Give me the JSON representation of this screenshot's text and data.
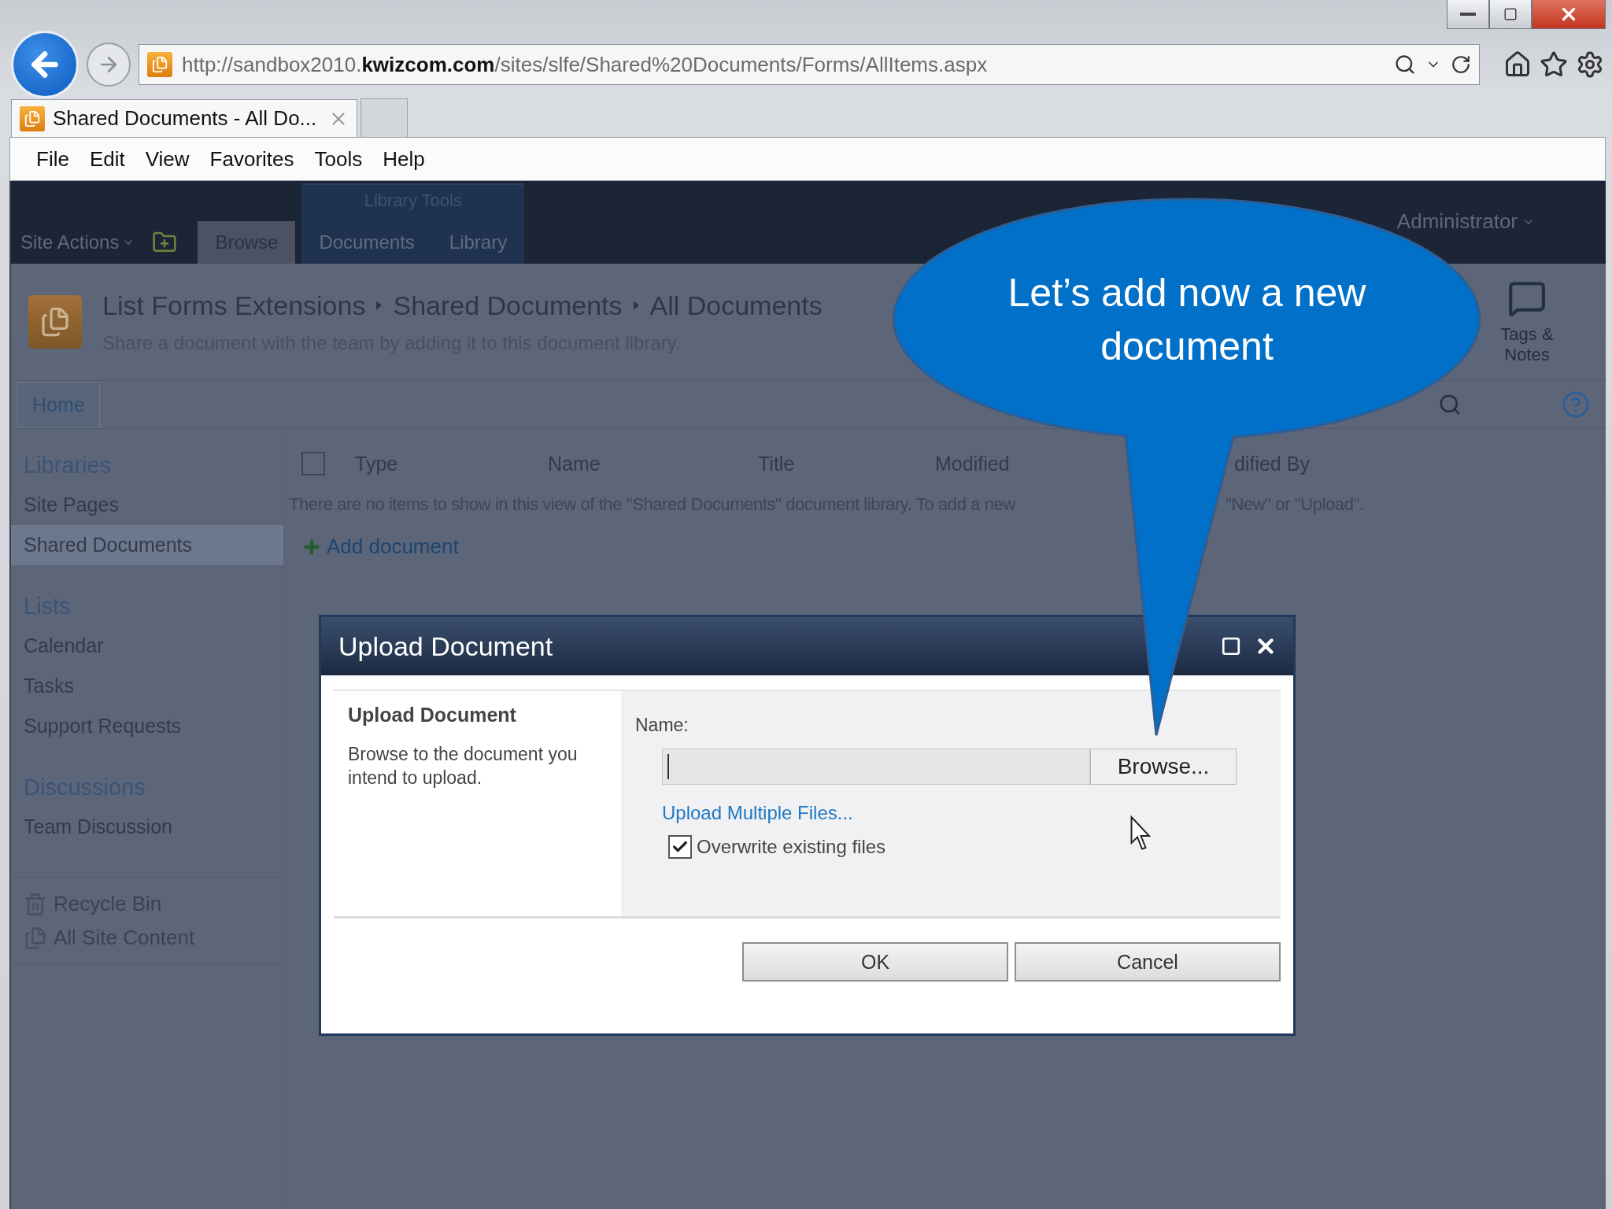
{
  "browser": {
    "address": "http://sandbox2010.**kwizcom.com**/sites/slfe/Shared%20Documents/Forms/AllItems.aspx",
    "tabs": [
      {
        "title": "Shared Documents - All Do...",
        "selected": true
      }
    ],
    "menu": [
      "File",
      "Edit",
      "View",
      "Favorites",
      "Tools",
      "Help"
    ]
  },
  "ribbon": {
    "site_actions": "Site Actions",
    "group_label": "Library Tools",
    "tabs": [
      {
        "label": "Browse",
        "selected": true
      },
      {
        "label": "Documents",
        "selected": false
      },
      {
        "label": "Library",
        "selected": false
      }
    ],
    "user": "Administrator"
  },
  "page": {
    "breadcrumb": [
      "List Forms Extensions",
      "Shared Documents",
      "All Documents"
    ],
    "description": "Share a document with the team by adding it to this document library.",
    "tags_notes": "Tags & Notes",
    "nav": [
      {
        "label": "Home",
        "selected": true
      }
    ]
  },
  "quick_launch": {
    "sections": [
      {
        "heading": "Libraries",
        "items": [
          {
            "label": "Site Pages",
            "selected": false
          },
          {
            "label": "Shared Documents",
            "selected": true
          }
        ]
      },
      {
        "heading": "Lists",
        "items": [
          {
            "label": "Calendar",
            "selected": false
          },
          {
            "label": "Tasks",
            "selected": false
          },
          {
            "label": "Support Requests",
            "selected": false
          }
        ]
      },
      {
        "heading": "Discussions",
        "items": [
          {
            "label": "Team Discussion",
            "selected": false
          }
        ]
      }
    ],
    "footer": [
      {
        "kind": "recycle",
        "label": "Recycle Bin"
      },
      {
        "kind": "content",
        "label": "All Site Content"
      }
    ]
  },
  "list": {
    "select_all_checked": false,
    "columns": [
      "Type",
      "Name",
      "Title",
      "Modified",
      "dified By"
    ],
    "empty_message": [
      "There are no items to show in this view of the \"Shared Documents\" document library. To add a new",
      "\"New\" or \"Upload\"."
    ],
    "add_link": "Add document"
  },
  "dialog": {
    "title": "Upload Document",
    "section_title": "Upload Document",
    "section_text": "Browse to the document you intend to upload.",
    "name_label": "Name:",
    "browse": "Browse...",
    "upload_multiple": "Upload Multiple Files...",
    "overwrite": {
      "label": "Overwrite existing files",
      "checked": true
    },
    "buttons": [
      "OK",
      "Cancel"
    ]
  },
  "callout": {
    "text": "Let’s add now a new document"
  }
}
